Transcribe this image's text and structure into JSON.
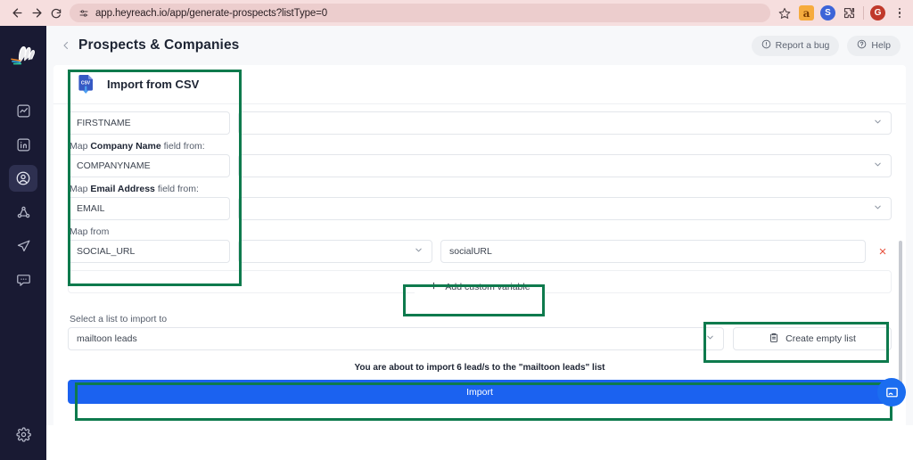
{
  "browser": {
    "url": "app.heyreach.io/app/generate-prospects?listType=0",
    "back_icon": "back-arrow-icon",
    "forward_icon": "forward-arrow-icon",
    "reload_icon": "reload-icon",
    "site_settings_icon": "site-settings-icon",
    "bookmark_icon": "star-icon",
    "extensions": [
      {
        "name": "grammarly-extension-icon",
        "label": "a"
      },
      {
        "name": "blue-extension-icon",
        "label": "S"
      },
      {
        "name": "extensions-puzzle-icon",
        "label": ""
      },
      {
        "name": "profile-avatar-icon",
        "label": "G"
      }
    ],
    "menu_icon": "kebab-menu-icon"
  },
  "sidebar": {
    "logo_name": "heyreach-logo",
    "items": [
      {
        "name": "sidebar-item-analytics",
        "icon": "chart-trend-icon",
        "active": false
      },
      {
        "name": "sidebar-item-linkedin",
        "icon": "linkedin-icon",
        "active": false
      },
      {
        "name": "sidebar-item-prospects",
        "icon": "person-circle-icon",
        "active": true
      },
      {
        "name": "sidebar-item-network",
        "icon": "network-share-icon",
        "active": false
      },
      {
        "name": "sidebar-item-campaigns",
        "icon": "paper-plane-icon",
        "active": false
      },
      {
        "name": "sidebar-item-inbox",
        "icon": "chat-bubble-icon",
        "active": false
      }
    ],
    "settings": {
      "name": "sidebar-item-settings",
      "icon": "gear-icon"
    }
  },
  "header": {
    "back_icon": "chevron-left-icon",
    "title": "Prospects & Companies",
    "report_bug_label": "Report a bug",
    "report_bug_icon": "alert-circle-icon",
    "help_label": "Help",
    "help_icon": "question-circle-icon"
  },
  "card": {
    "icon": "csv-file-icon",
    "icon_text": "CSV",
    "title": "Import from CSV"
  },
  "mapping": {
    "rows": [
      {
        "label_prefix": "",
        "label_bold": "",
        "label_suffix": "",
        "value": "FIRSTNAME",
        "has_label": false
      },
      {
        "label_prefix": "Map ",
        "label_bold": "Company Name",
        "label_suffix": " field from:",
        "value": "COMPANYNAME",
        "has_label": true
      },
      {
        "label_prefix": "Map ",
        "label_bold": "Email Address",
        "label_suffix": " field from:",
        "value": "EMAIL",
        "has_label": true
      }
    ],
    "custom_row": {
      "label": "Map from",
      "value": "SOCIAL_URL",
      "mid_value": "",
      "variable_name": "socialURL",
      "remove_icon": "remove-x-icon",
      "remove_label": "×"
    }
  },
  "actions": {
    "add_custom_variable_label": "Add custom variable",
    "add_custom_variable_icon": "plus-icon",
    "select_list_label": "Select a list to import to",
    "selected_list": "mailtoon leads",
    "create_empty_list_label": "Create empty list",
    "create_empty_list_icon": "clipboard-list-icon",
    "import_note": "You are about to import 6 lead/s to the \"mailtoon leads\" list",
    "import_label": "Import"
  },
  "widgets": {
    "chat_icon": "chat-widget-icon",
    "scrollbar": "vertical-scrollbar"
  },
  "colors": {
    "accent_blue": "#1b62f0",
    "highlight_green": "#0e7a4d",
    "sidebar_bg": "#191a33",
    "browser_bar": "#f6dede",
    "remove_red": "#e8533f"
  }
}
